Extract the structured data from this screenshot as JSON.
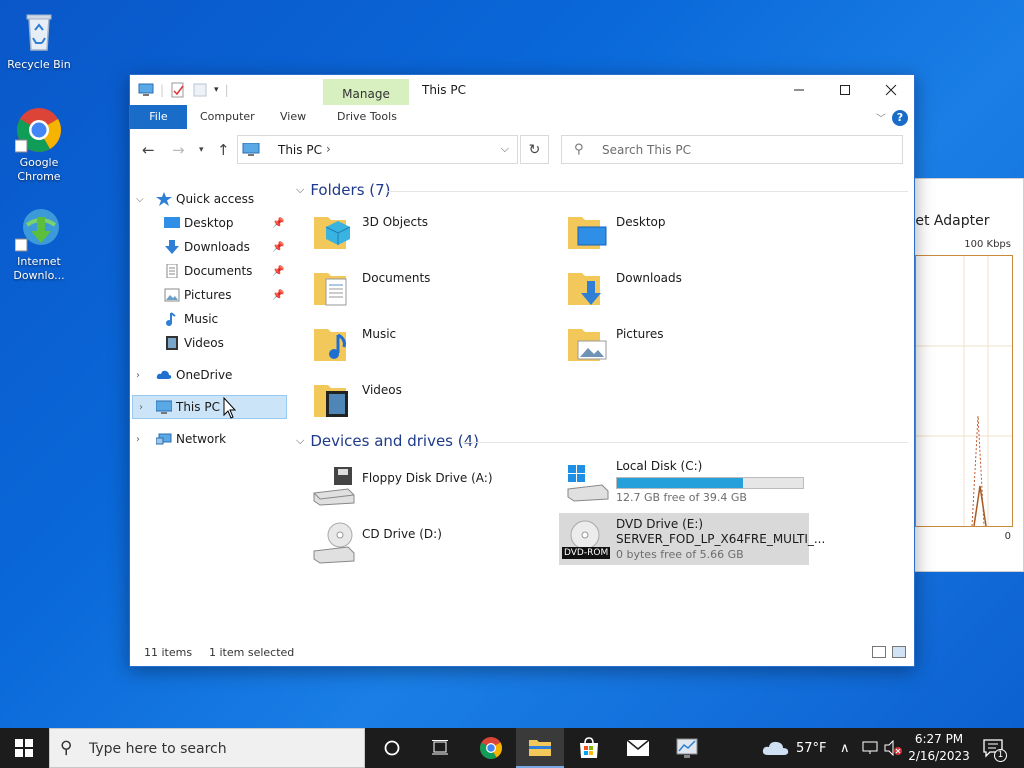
{
  "desktop": {
    "icons": [
      {
        "label": "Recycle Bin"
      },
      {
        "label": "Google Chrome"
      },
      {
        "label": "Internet Downlo..."
      }
    ]
  },
  "bg_window": {
    "title": "rnet Adapter",
    "scale_top": "100 Kbps",
    "scale_bottom": "0"
  },
  "explorer": {
    "title": "This PC",
    "manage_tab": "Manage",
    "ribbon": {
      "tabs": [
        "File",
        "Computer",
        "View",
        "Drive Tools"
      ]
    },
    "address": {
      "crumb": "This PC",
      "separator": "›"
    },
    "search": {
      "placeholder": "Search This PC"
    },
    "nav": {
      "quick_access": "Quick access",
      "quick_items": [
        "Desktop",
        "Downloads",
        "Documents",
        "Pictures",
        "Music",
        "Videos"
      ],
      "onedrive": "OneDrive",
      "this_pc": "This PC",
      "network": "Network"
    },
    "folders": {
      "heading": "Folders (7)",
      "items": [
        "3D Objects",
        "Desktop",
        "Documents",
        "Downloads",
        "Music",
        "Pictures",
        "Videos"
      ]
    },
    "devices": {
      "heading": "Devices and drives (4)",
      "floppy": "Floppy Disk Drive (A:)",
      "local_c": {
        "name": "Local Disk (C:)",
        "free": "12.7 GB free of 39.4 GB",
        "used_fraction": 0.68
      },
      "cd_d": "CD Drive (D:)",
      "dvd_e": {
        "name": "DVD Drive (E:)",
        "label": "SERVER_FOD_LP_X64FRE_MULTI_...",
        "free": "0 bytes free of 5.66 GB",
        "badge": "DVD-ROM"
      }
    },
    "status": {
      "items": "11 items",
      "selected": "1 item selected"
    }
  },
  "taskbar": {
    "search_placeholder": "Type here to search",
    "weather": "57°F",
    "time": "6:27 PM",
    "date": "2/16/2023",
    "notification_count": "1"
  },
  "colors": {
    "accent": "#1a6cc9",
    "folder": "#f3c85b",
    "bar_fill": "#26a0da",
    "manage_tab": "#d8f0c0"
  }
}
